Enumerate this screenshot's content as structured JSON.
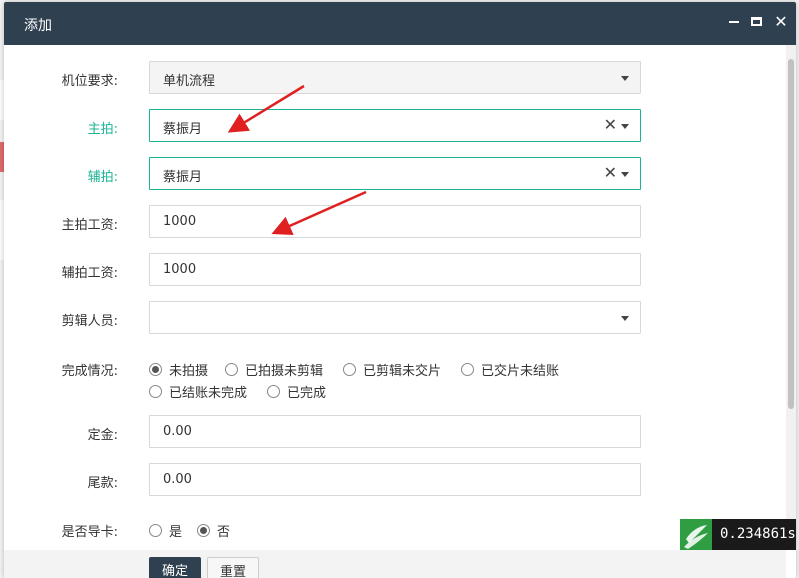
{
  "modal": {
    "title": "添加",
    "close_glyph": "✕"
  },
  "form": {
    "position_req": {
      "label": "机位要求:",
      "value": "单机流程"
    },
    "main_shooter": {
      "label": "主拍:",
      "value": "蔡振月"
    },
    "assistant_shooter": {
      "label": "辅拍:",
      "value": "蔡振月"
    },
    "main_salary": {
      "label": "主拍工资:",
      "value": "1000"
    },
    "assistant_salary": {
      "label": "辅拍工资:",
      "value": "1000"
    },
    "editor": {
      "label": "剪辑人员:",
      "value": ""
    },
    "status": {
      "label": "完成情况:",
      "options": [
        "未拍摄",
        "已拍摄未剪辑",
        "已剪辑未交片",
        "已交片未结账",
        "已结账未完成",
        "已完成"
      ],
      "selected": "未拍摄"
    },
    "deposit": {
      "label": "定金:",
      "value": "0.00"
    },
    "balance": {
      "label": "尾款:",
      "value": "0.00"
    },
    "card_import": {
      "label": "是否导卡:",
      "options": [
        "是",
        "否"
      ],
      "selected": "否"
    },
    "clear_glyph": "✕"
  },
  "buttons": {
    "ok": "确定",
    "reset": "重置"
  },
  "timer": {
    "value": "0.234861s"
  },
  "colors": {
    "header": "#2f4050",
    "accent": "#1ab394",
    "arrow": "#e02020"
  }
}
